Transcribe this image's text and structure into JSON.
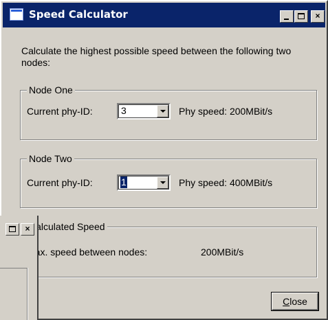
{
  "window": {
    "title": "Speed Calculator",
    "title_buttons": {
      "minimize": "",
      "maximize": "",
      "close": "×"
    }
  },
  "description": "Calculate the highest possible speed between the following two nodes:",
  "node_one": {
    "group_label": "Node One",
    "phy_label": "Current phy-ID:",
    "phy_value": "3",
    "speed_text": "Phy speed: 200MBit/s"
  },
  "node_two": {
    "group_label": "Node Two",
    "phy_label": "Current phy-ID:",
    "phy_value": "1",
    "speed_text": "Phy speed: 400MBit/s"
  },
  "calculated": {
    "group_label": "Calculated Speed",
    "max_label": "Max. speed between nodes:",
    "max_value": "200MBit/s"
  },
  "close_button": {
    "underlined": "C",
    "rest": "lose"
  },
  "background_window": {
    "close": "×"
  },
  "colors": {
    "titlebar": "#0a246a",
    "face": "#d4d0c8",
    "selection": "#0a246a"
  }
}
